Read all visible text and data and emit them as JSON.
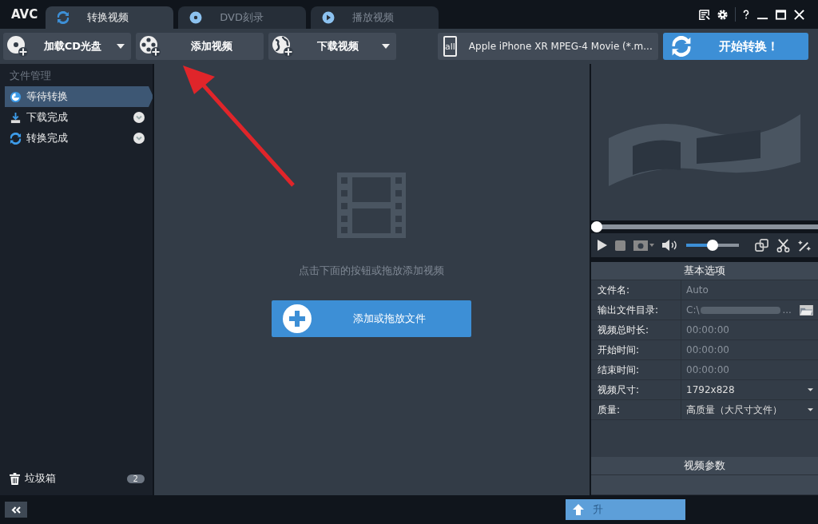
{
  "app_logo": "AVC",
  "tabs": [
    {
      "label": "转换视频",
      "selected": true,
      "kind": "convert"
    },
    {
      "label": "DVD刻录",
      "selected": false,
      "kind": "dvd"
    },
    {
      "label": "播放视频",
      "selected": false,
      "kind": "play"
    }
  ],
  "toolbar": {
    "buttons": [
      {
        "label": "加载CD光盘",
        "kind": "disc",
        "dropdown": true
      },
      {
        "label": "添加视频",
        "kind": "film",
        "dropdown": false
      },
      {
        "label": "下载视频",
        "kind": "globe",
        "dropdown": true
      }
    ],
    "profile": {
      "icon_text": "all",
      "value": "Apple iPhone XR MPEG-4 Movie (*.m..."
    },
    "start_button": "开始转换！"
  },
  "sidebar": {
    "heading": "文件管理",
    "items": [
      {
        "label": "等待转换",
        "selected": true,
        "kind": "waiting",
        "expandable": false
      },
      {
        "label": "下载完成",
        "selected": false,
        "kind": "download",
        "expandable": true
      },
      {
        "label": "转换完成",
        "selected": false,
        "kind": "done",
        "expandable": true
      }
    ],
    "trash": {
      "label": "垃圾箱",
      "count": "2"
    }
  },
  "main": {
    "hint": "点击下面的按钮或拖放添加视频",
    "add_button": "添加或拖放文件"
  },
  "player": {
    "progress": {
      "level": 0
    },
    "volume": {
      "level": 0.5
    }
  },
  "options": {
    "title": "基本选项",
    "rows": [
      {
        "label": "文件名:",
        "value": "Auto",
        "kind": "text"
      },
      {
        "label": "输出文件目录:",
        "value": "C:\\",
        "tail": "...",
        "kind": "path"
      },
      {
        "label": "视频总时长:",
        "value": "00:00:00",
        "kind": "text"
      },
      {
        "label": "开始时间:",
        "value": "00:00:00",
        "kind": "text"
      },
      {
        "label": "结束时间:",
        "value": "00:00:00",
        "kind": "text"
      },
      {
        "label": "视频尺寸:",
        "value": "1792x828",
        "kind": "select"
      },
      {
        "label": "质量:",
        "value": "高质量（大尺寸文件）",
        "kind": "select"
      }
    ],
    "section_2": "视频参数"
  },
  "footer": {
    "upgrade_button": "升"
  }
}
